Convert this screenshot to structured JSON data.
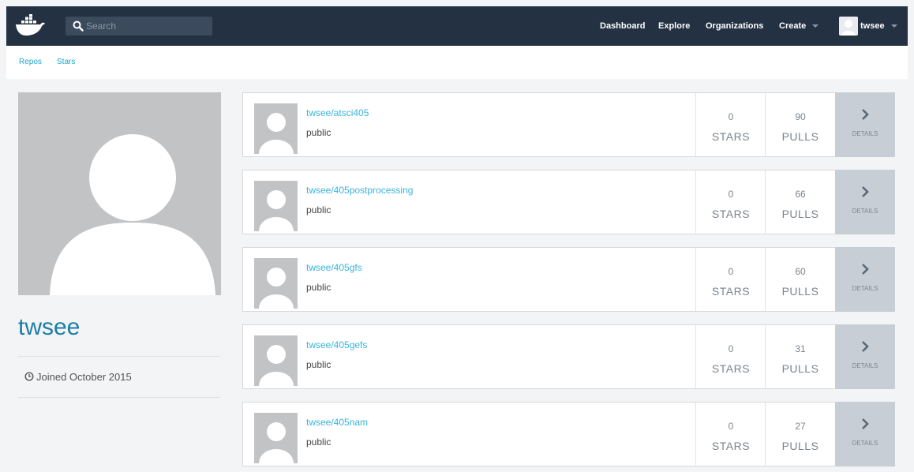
{
  "search": {
    "placeholder": "Search"
  },
  "nav": {
    "dashboard": "Dashboard",
    "explore": "Explore",
    "organizations": "Organizations",
    "create": "Create",
    "user": "twsee"
  },
  "subnav": {
    "repos": "Repos",
    "stars": "Stars"
  },
  "profile": {
    "username": "twsee",
    "joined": "Joined October 2015"
  },
  "repos": [
    {
      "name": "twsee/atsci405",
      "visibility": "public",
      "stars": "0",
      "stars_label": "STARS",
      "pulls": "90",
      "pulls_label": "PULLS",
      "details": "DETAILS"
    },
    {
      "name": "twsee/405postprocessing",
      "visibility": "public",
      "stars": "0",
      "stars_label": "STARS",
      "pulls": "66",
      "pulls_label": "PULLS",
      "details": "DETAILS"
    },
    {
      "name": "twsee/405gfs",
      "visibility": "public",
      "stars": "0",
      "stars_label": "STARS",
      "pulls": "60",
      "pulls_label": "PULLS",
      "details": "DETAILS"
    },
    {
      "name": "twsee/405gefs",
      "visibility": "public",
      "stars": "0",
      "stars_label": "STARS",
      "pulls": "31",
      "pulls_label": "PULLS",
      "details": "DETAILS"
    },
    {
      "name": "twsee/405nam",
      "visibility": "public",
      "stars": "0",
      "stars_label": "STARS",
      "pulls": "27",
      "pulls_label": "PULLS",
      "details": "DETAILS"
    }
  ],
  "colors": {
    "topbar": "#233143",
    "link": "#37b5dc",
    "username": "#1d7da8",
    "details_bg": "#c7ced6"
  }
}
